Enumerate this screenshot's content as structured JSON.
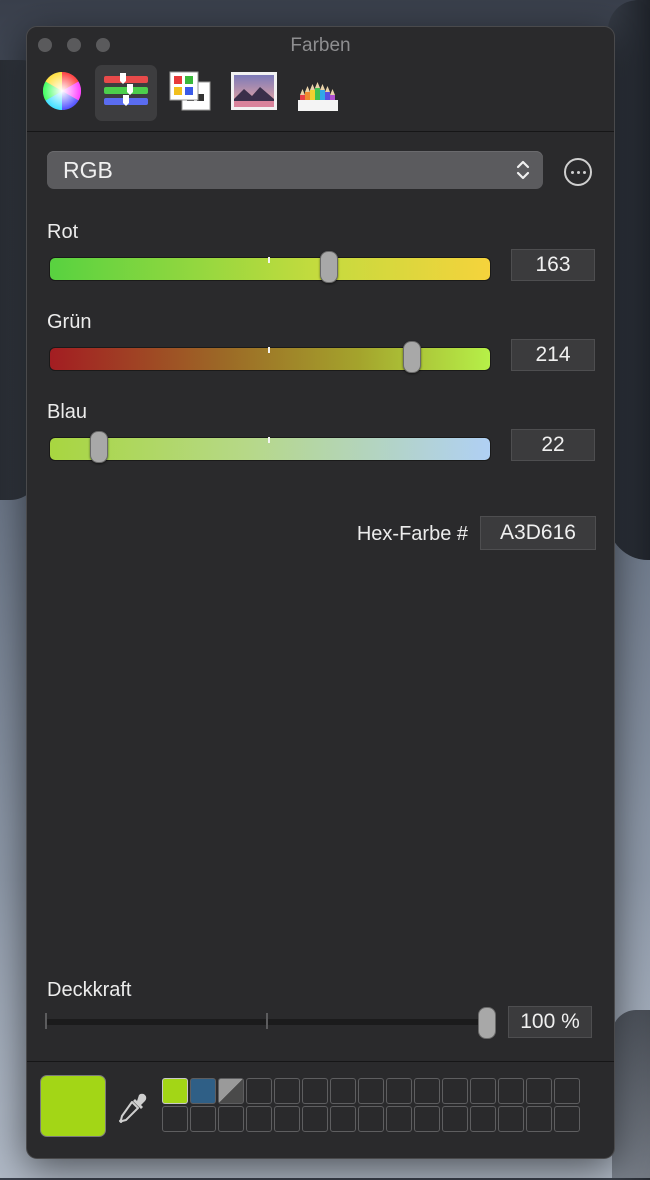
{
  "window": {
    "title": "Farben"
  },
  "toolbar": {
    "tabs": [
      {
        "name": "color-wheel",
        "icon": "color-wheel-icon",
        "active": false
      },
      {
        "name": "color-sliders",
        "icon": "sliders-icon",
        "active": true
      },
      {
        "name": "color-palettes",
        "icon": "palettes-icon",
        "active": false
      },
      {
        "name": "image-palettes",
        "icon": "image-palette-icon",
        "active": false
      },
      {
        "name": "pencils",
        "icon": "pencils-icon",
        "active": false
      }
    ]
  },
  "mode_popup": {
    "selected": "RGB"
  },
  "sliders": [
    {
      "label": "Rot",
      "value": "163",
      "fraction": 0.639
    },
    {
      "label": "Grün",
      "value": "214",
      "fraction": 0.839
    },
    {
      "label": "Blau",
      "value": "22",
      "fraction": 0.086
    }
  ],
  "hex": {
    "label": "Hex-Farbe #",
    "value": "A3D616"
  },
  "opacity": {
    "label": "Deckkraft",
    "value": "100 %",
    "fraction": 1.0
  },
  "colors": {
    "current": "#A3D616",
    "swatch_1": "#A3D616",
    "swatch_2": "#2F5F86"
  }
}
